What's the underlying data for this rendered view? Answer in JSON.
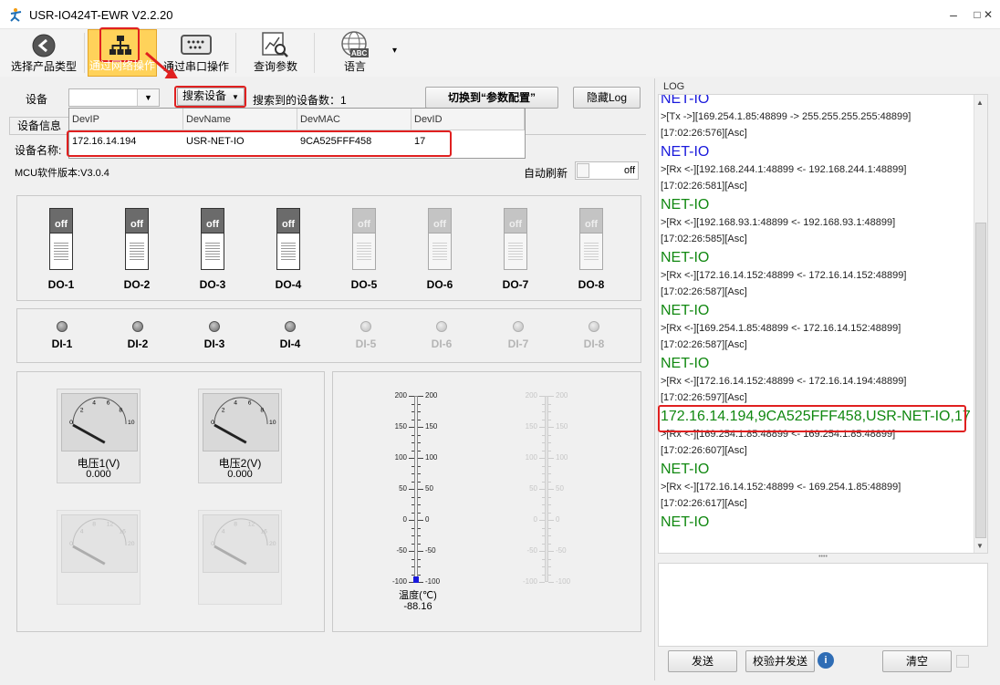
{
  "window": {
    "title": "USR-IO424T-EWR V2.2.20",
    "min": "–",
    "max": "□",
    "close": "✕"
  },
  "toolbar": {
    "items": [
      {
        "label": "选择产品类型",
        "icon": "back-arrow-icon"
      },
      {
        "label": "通过网络操作",
        "icon": "network-icon"
      },
      {
        "label": "通过串口操作",
        "icon": "serial-port-icon"
      },
      {
        "label": "查询参数",
        "icon": "query-chart-icon"
      },
      {
        "label": "语言",
        "icon": "globe-abc-icon",
        "badge": "ABC"
      }
    ],
    "dropdown_arrow": "▾"
  },
  "device_bar": {
    "device_label": "设备",
    "search_button": "搜索设备",
    "found_label": "搜索到的设备数：",
    "found_count": "1",
    "switch_button": "切换到“参数配置”",
    "hide_log_button": "隐藏Log"
  },
  "device_table": {
    "columns": [
      "DevIP",
      "DevName",
      "DevMAC",
      "DevID"
    ],
    "rows": [
      [
        "172.16.14.194",
        "USR-NET-IO",
        "9CA525FFF458",
        "17"
      ]
    ]
  },
  "device_info": {
    "tab": "设备信息",
    "name_label": "设备名称:",
    "mcu_label": "MCU软件版本:",
    "mcu_version": "V3.0.4",
    "auto_refresh_label": "自动刷新",
    "auto_refresh_state": "off"
  },
  "outputs": [
    {
      "label": "DO-1",
      "state": "off",
      "enabled": true
    },
    {
      "label": "DO-2",
      "state": "off",
      "enabled": true
    },
    {
      "label": "DO-3",
      "state": "off",
      "enabled": true
    },
    {
      "label": "DO-4",
      "state": "off",
      "enabled": true
    },
    {
      "label": "DO-5",
      "state": "off",
      "enabled": false
    },
    {
      "label": "DO-6",
      "state": "off",
      "enabled": false
    },
    {
      "label": "DO-7",
      "state": "off",
      "enabled": false
    },
    {
      "label": "DO-8",
      "state": "off",
      "enabled": false
    }
  ],
  "inputs": [
    {
      "label": "DI-1",
      "enabled": true
    },
    {
      "label": "DI-2",
      "enabled": true
    },
    {
      "label": "DI-3",
      "enabled": true
    },
    {
      "label": "DI-4",
      "enabled": true
    },
    {
      "label": "DI-5",
      "enabled": false
    },
    {
      "label": "DI-6",
      "enabled": false
    },
    {
      "label": "DI-7",
      "enabled": false
    },
    {
      "label": "DI-8",
      "enabled": false
    }
  ],
  "gauges": [
    {
      "label": "电压1(V)",
      "value": "0.000",
      "scale": [
        "0",
        "2",
        "4",
        "6",
        "8",
        "10"
      ]
    },
    {
      "label": "电压2(V)",
      "value": "0.000",
      "scale": [
        "0",
        "2",
        "4",
        "6",
        "8",
        "10"
      ]
    },
    {
      "label": "",
      "value": "",
      "scale": [
        "0",
        "4",
        "8",
        "12",
        "16",
        "20"
      ]
    },
    {
      "label": "",
      "value": "",
      "scale": [
        "0",
        "4",
        "8",
        "12",
        "16",
        "20"
      ]
    }
  ],
  "thermometer": {
    "label": "温度(℃)",
    "value": "-88.16",
    "ticks": [
      "200",
      "150",
      "100",
      "50",
      "0",
      "-50",
      "-100"
    ]
  },
  "log": {
    "title": "LOG",
    "lines": [
      {
        "text": "NET-IO",
        "kind": "big",
        "color": "blue"
      },
      {
        "text": ">[Tx ->][169.254.1.85:48899 -> 255.255.255.255:48899]",
        "kind": "small"
      },
      {
        "text": "[17:02:26:576][Asc]",
        "kind": "small"
      },
      {
        "text": "NET-IO",
        "kind": "big",
        "color": "blue"
      },
      {
        "text": ">[Rx <-][192.168.244.1:48899 <- 192.168.244.1:48899]",
        "kind": "small"
      },
      {
        "text": "[17:02:26:581][Asc]",
        "kind": "small"
      },
      {
        "text": "NET-IO",
        "kind": "big",
        "color": "green"
      },
      {
        "text": ">[Rx <-][192.168.93.1:48899 <- 192.168.93.1:48899]",
        "kind": "small"
      },
      {
        "text": "[17:02:26:585][Asc]",
        "kind": "small"
      },
      {
        "text": "NET-IO",
        "kind": "big",
        "color": "green"
      },
      {
        "text": ">[Rx <-][172.16.14.152:48899 <- 172.16.14.152:48899]",
        "kind": "small"
      },
      {
        "text": "[17:02:26:587][Asc]",
        "kind": "small"
      },
      {
        "text": "NET-IO",
        "kind": "big",
        "color": "green"
      },
      {
        "text": ">[Rx <-][169.254.1.85:48899 <- 172.16.14.152:48899]",
        "kind": "small"
      },
      {
        "text": "[17:02:26:587][Asc]",
        "kind": "small"
      },
      {
        "text": "NET-IO",
        "kind": "big",
        "color": "green"
      },
      {
        "text": ">[Rx <-][172.16.14.152:48899 <- 172.16.14.194:48899]",
        "kind": "small"
      },
      {
        "text": "[17:02:26:597][Asc]",
        "kind": "small"
      },
      {
        "text": "172.16.14.194,9CA525FFF458,USR-NET-IO,17",
        "kind": "big",
        "color": "green"
      },
      {
        "text": ">[Rx <-][169.254.1.85:48899 <- 169.254.1.85:48899]",
        "kind": "small"
      },
      {
        "text": "[17:02:26:607][Asc]",
        "kind": "small"
      },
      {
        "text": "NET-IO",
        "kind": "big",
        "color": "green"
      },
      {
        "text": ">[Rx <-][172.16.14.152:48899 <- 169.254.1.85:48899]",
        "kind": "small"
      },
      {
        "text": "[17:02:26:617][Asc]",
        "kind": "small"
      },
      {
        "text": "NET-IO",
        "kind": "big",
        "color": "green"
      }
    ],
    "splitter_grip": "••••",
    "send_button": "发送",
    "check_send_button": "校验并发送",
    "info_icon": "i",
    "clear_button": "清空"
  },
  "colors": {
    "highlight": "#e02020",
    "log_blue": "#1a1adc",
    "log_green": "#118811",
    "active_tool": "#ffd25a"
  }
}
